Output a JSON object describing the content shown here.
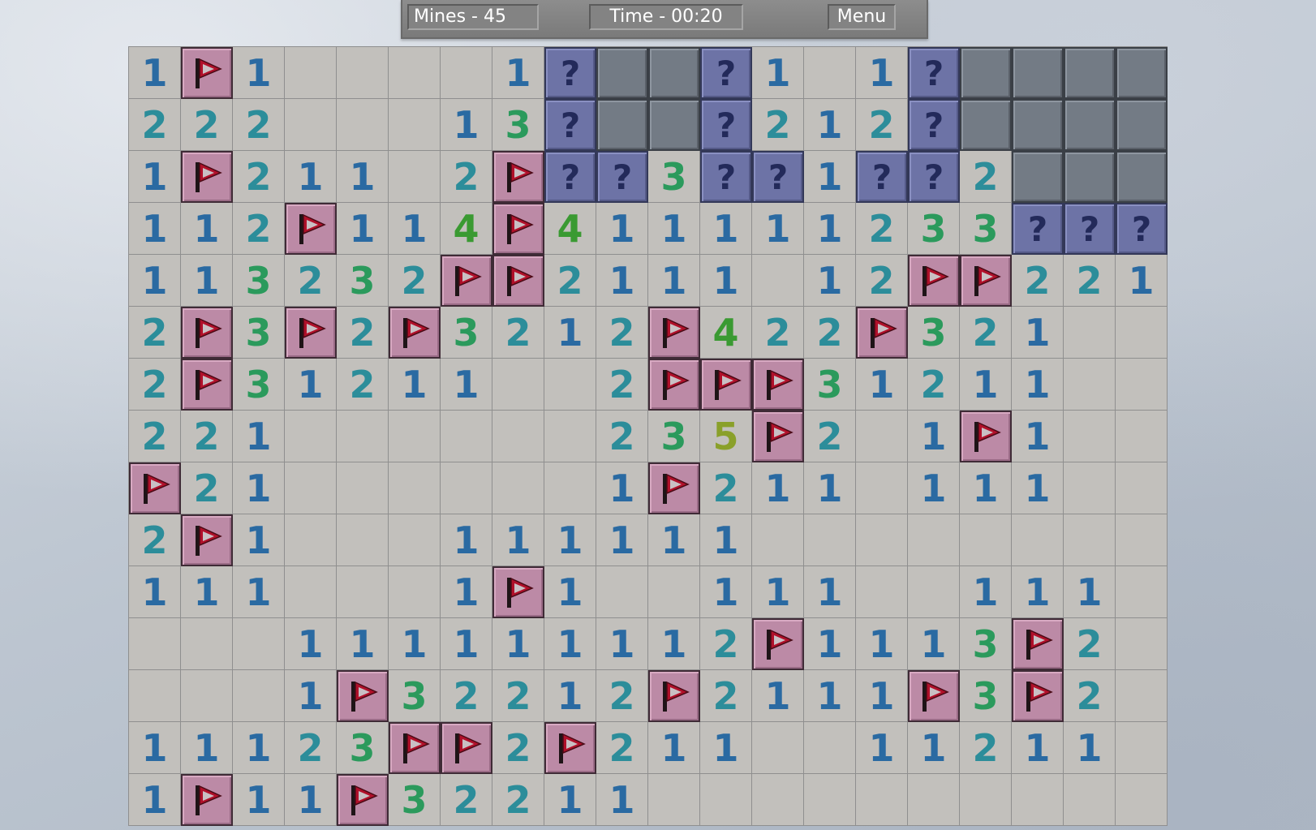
{
  "header": {
    "mines_label": "Mines - 45",
    "time_label": "Time - 00:20",
    "menu_label": "Menu"
  },
  "board": {
    "cols": 20,
    "rows": 15,
    "legend": {
      "F": "flag",
      "?": "question",
      "H": "hidden",
      ".": "open-empty",
      "1-8": "open-number"
    },
    "grid": [
      "1F1....1?H?H?1.1?HHHHH",
      "222...13?HH?212?HHHH",
      "1F211.2F??3??1??2HHH",
      "112F11 4F4111112 33???",
      "11323 2FF2111.12FF221",
      "2F3F2F3212F422F321..",
      "2F31211..2FFF31211..",
      "221......235F2.1F1..",
      "F21......1F211.111..",
      "2F1...111111........",
      "111...1F1..111..111.",
      "...11111111.2F1113F2",
      "...1F3221 2F2111F3F2",
      "11123FF2F211..11211.",
      "1F11F32211.........."
    ],
    "cells": [
      [
        "1",
        "F",
        "1",
        ".",
        ".",
        ".",
        ".",
        "1",
        "?",
        "H",
        "H",
        "?",
        "1",
        ".",
        "1",
        "?",
        "H",
        "H",
        "H",
        "H"
      ],
      [
        "2",
        "2",
        "2",
        ".",
        ".",
        ".",
        "1",
        "3",
        "?",
        "H",
        "H",
        "?",
        "2",
        "1",
        "2",
        "?",
        "H",
        "H",
        "H",
        "H"
      ],
      [
        "1",
        "F",
        "2",
        "1",
        "1",
        ".",
        "2",
        "F",
        "?",
        "?",
        "3",
        "?",
        "?",
        "1",
        "?",
        "?",
        "2",
        "H",
        "H",
        "H"
      ],
      [
        "1",
        "1",
        "2",
        "F",
        "1",
        "1",
        "4",
        "F",
        "4",
        "1",
        "1",
        "1",
        "1",
        "1",
        "2",
        "3",
        "3",
        "?",
        "?",
        "?"
      ],
      [
        "1",
        "1",
        "3",
        "2",
        "3",
        "2",
        "F",
        "F",
        "2",
        "1",
        "1",
        "1",
        ".",
        "1",
        "2",
        "F",
        "F",
        "2",
        "2",
        "1"
      ],
      [
        "2",
        "F",
        "3",
        "F",
        "2",
        "F",
        "3",
        "2",
        "1",
        "2",
        "F",
        "4",
        "2",
        "2",
        "F",
        "3",
        "2",
        "1",
        ".",
        "."
      ],
      [
        "2",
        "F",
        "3",
        "1",
        "2",
        "1",
        "1",
        ".",
        ".",
        "2",
        "F",
        "F",
        "F",
        "3",
        "1",
        "2",
        "1",
        "1",
        ".",
        "."
      ],
      [
        "2",
        "2",
        "1",
        ".",
        ".",
        ".",
        ".",
        ".",
        ".",
        "2",
        "3",
        "5",
        "F",
        "2",
        ".",
        "1",
        "F",
        "1",
        ".",
        "."
      ],
      [
        "F",
        "2",
        "1",
        ".",
        ".",
        ".",
        ".",
        ".",
        ".",
        "1",
        "F",
        "2",
        "1",
        "1",
        ".",
        "1",
        "1",
        "1",
        ".",
        "."
      ],
      [
        "2",
        "F",
        "1",
        ".",
        ".",
        ".",
        "1",
        "1",
        "1",
        "1",
        "1",
        "1",
        ".",
        ".",
        ".",
        ".",
        ".",
        ".",
        ".",
        "."
      ],
      [
        "1",
        "1",
        "1",
        ".",
        ".",
        ".",
        "1",
        "F",
        "1",
        ".",
        ".",
        "1",
        "1",
        "1",
        ".",
        ".",
        "1",
        "1",
        "1",
        "."
      ],
      [
        ".",
        ".",
        ".",
        "1",
        "1",
        "1",
        "1",
        "1",
        "1",
        "1",
        "1",
        "2",
        "F",
        "1",
        "1",
        "1",
        "3",
        "F",
        "2",
        "."
      ],
      [
        ".",
        ".",
        ".",
        "1",
        "F",
        "3",
        "2",
        "2",
        "1",
        "2",
        "F",
        "2",
        "1",
        "1",
        "1",
        "F",
        "3",
        "F",
        "2",
        "."
      ],
      [
        "1",
        "1",
        "1",
        "2",
        "3",
        "F",
        "F",
        "2",
        "F",
        "2",
        "1",
        "1",
        ".",
        ".",
        "1",
        "1",
        "2",
        "1",
        "1",
        "."
      ],
      [
        "1",
        "F",
        "1",
        "1",
        "F",
        "3",
        "2",
        "2",
        "1",
        "1",
        ".",
        ".",
        ".",
        ".",
        ".",
        ".",
        ".",
        ".",
        ".",
        "."
      ]
    ]
  },
  "colors": {
    "number_1": "#2a6aa2",
    "number_2": "#2c8d9a",
    "number_3": "#2b9a5c",
    "number_4": "#3a9a32",
    "number_5": "#8aa02a",
    "flag_tile": "#bc8aa6",
    "flag_pennant": "#b0102a",
    "question_tile": "#6d73a6",
    "hidden_tile": "#737b85",
    "open_tile": "#c2c0bc"
  },
  "icons": {
    "flag": "flag-icon",
    "question": "question-mark-icon"
  }
}
